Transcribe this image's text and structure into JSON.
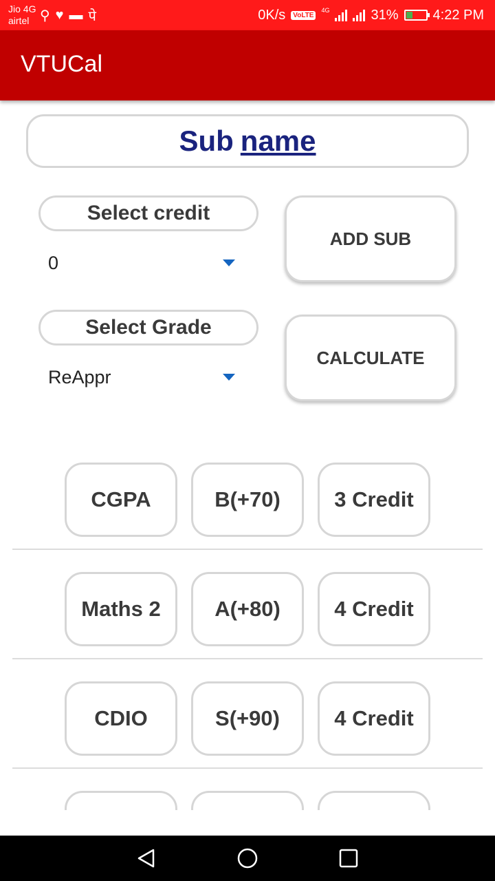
{
  "status_bar": {
    "carrier1": "Jio 4G",
    "carrier2": "airtel",
    "left_icons": [
      "usb-icon",
      "heart-icon",
      "train-icon",
      "pe-icon"
    ],
    "network_speed": "0K/s",
    "volte": "VoLTE",
    "network_type": "4G",
    "battery_percent": "31%",
    "battery_level": 0.31,
    "time": "4:22 PM"
  },
  "app_bar": {
    "title": "VTUCal"
  },
  "form": {
    "sub_name_part1": "Sub",
    "sub_name_part2": "name",
    "credit_label": "Select credit",
    "credit_value": "0",
    "grade_label": "Select Grade",
    "grade_value": "ReAppr",
    "add_button": "ADD SUB",
    "calc_button": "CALCULATE"
  },
  "rows": [
    {
      "name": "CGPA",
      "grade": "B(+70)",
      "credit": "3 Credit"
    },
    {
      "name": "Maths 2",
      "grade": "A(+80)",
      "credit": "4 Credit"
    },
    {
      "name": "CDIO",
      "grade": "S(+90)",
      "credit": "4 Credit"
    },
    {
      "name": "",
      "grade": "",
      "credit": ""
    }
  ],
  "colors": {
    "status_bar": "#ff1a1a",
    "app_bar": "#c00000",
    "sub_name_text": "#1a237e",
    "spinner_caret": "#1565c0",
    "border": "#d6d6d6"
  },
  "nav_bar": {
    "icons": [
      "back-icon",
      "home-icon",
      "recents-icon"
    ]
  }
}
